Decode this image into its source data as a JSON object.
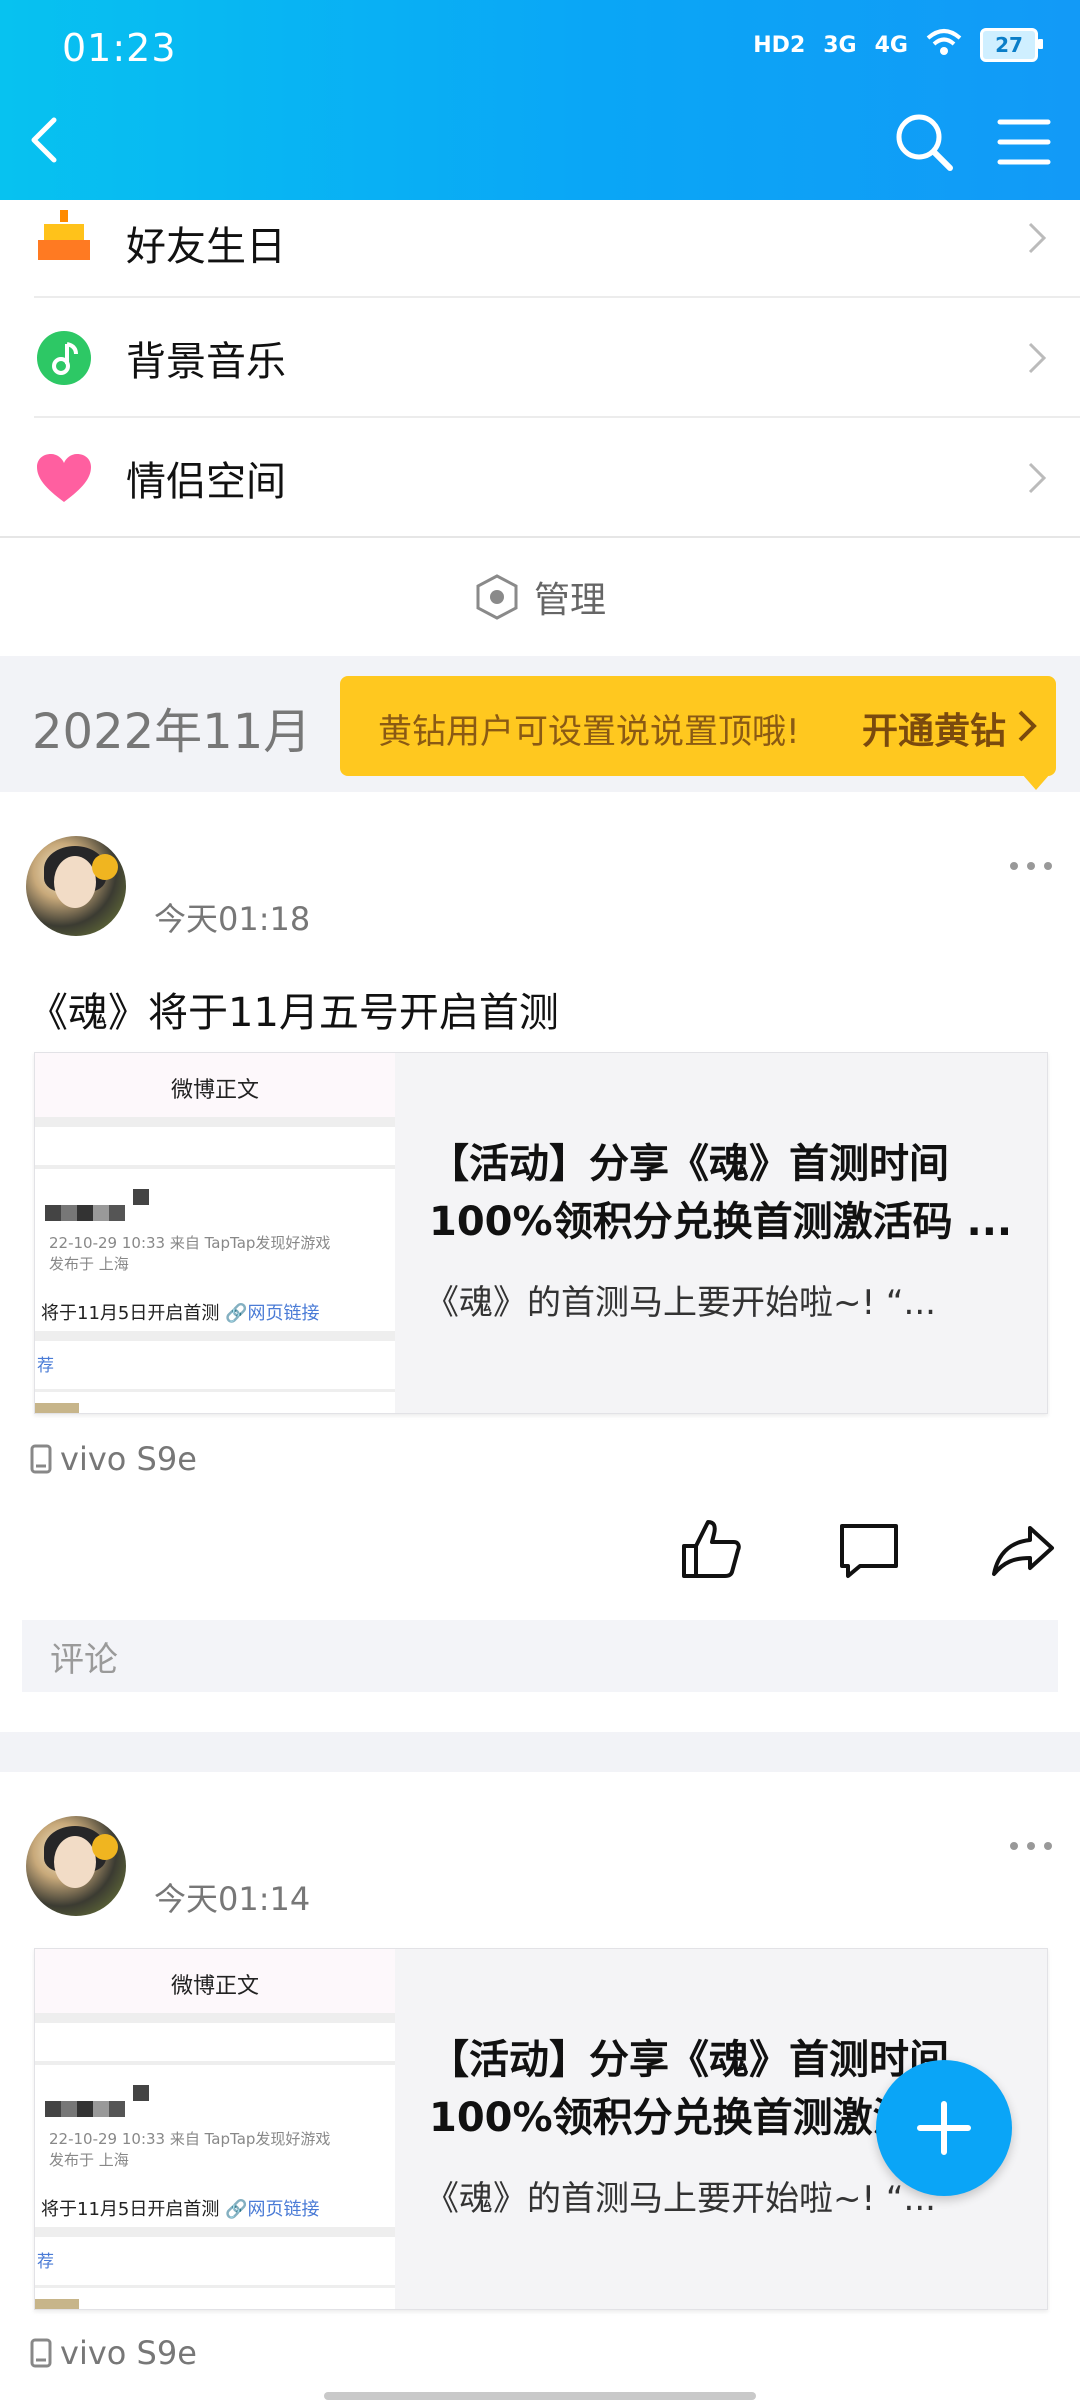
{
  "status_bar": {
    "time": "01:23",
    "network_hd": "HD2",
    "network_3g": "3G",
    "network_4g": "4G",
    "battery": "27"
  },
  "nav": {
    "back_icon": "chevron-left-icon",
    "search_icon": "search-icon",
    "menu_icon": "hamburger-menu-icon"
  },
  "menu": {
    "items": [
      {
        "label": "好友生日",
        "icon": "birthday-cake-icon"
      },
      {
        "label": "背景音乐",
        "icon": "music-note-icon"
      },
      {
        "label": "情侣空间",
        "icon": "heart-icon"
      }
    ],
    "manage_label": "管理"
  },
  "timeline": {
    "date_label": "2022年11月",
    "promo_text": "黄钻用户可设置说说置顶哦!",
    "promo_cta": "开通黄钻"
  },
  "posts": [
    {
      "time": "今天01:18",
      "text": "《魂》将于11月五号开启首测",
      "card": {
        "thumb_header": "微博正文",
        "thumb_meta1": "22-10-29 10:33  来自 TapTap发现好游戏",
        "thumb_meta2": "发布于 上海",
        "thumb_post": "将于11月5日开启首测",
        "thumb_link": "🔗网页链接",
        "thumb_rec": "荐",
        "title_line1": "【活动】分享《魂》首测时间",
        "title_line2": "100%领积分兑换首测激活码 ...",
        "desc": "《魂》的首测马上要开始啦~!  “..."
      },
      "device": "vivo S9e",
      "comment_placeholder": "评论"
    },
    {
      "time": "今天01:14",
      "card": {
        "thumb_header": "微博正文",
        "thumb_meta1": "22-10-29 10:33  来自 TapTap发现好游戏",
        "thumb_meta2": "发布于 上海",
        "thumb_post": "将于11月5日开启首测",
        "thumb_link": "🔗网页链接",
        "thumb_rec": "荐",
        "title_line1": "【活动】分享《魂》首测时间",
        "title_line2": "100%领积分兑换首测激活码 ...",
        "desc": "《魂》的首测马上要开始啦~!  “..."
      },
      "device": "vivo S9e"
    }
  ],
  "colors": {
    "header_blue": "#0aa6f6",
    "promo_yellow": "#ffc81f",
    "fab_blue": "#0aa5f7"
  }
}
